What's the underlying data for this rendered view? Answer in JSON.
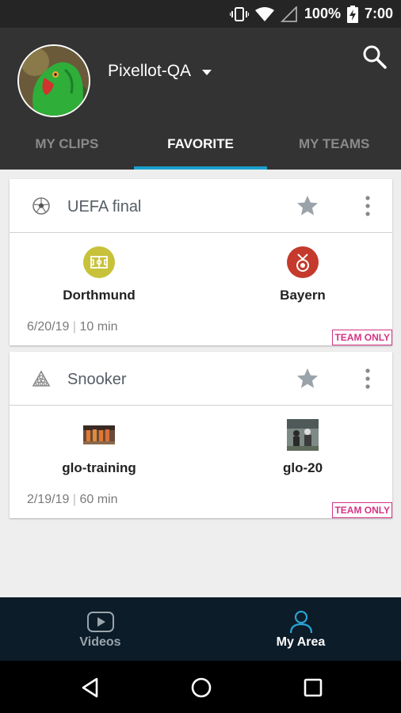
{
  "status_bar": {
    "battery": "100%",
    "time": "7:00"
  },
  "header": {
    "account_name": "Pixellot-QA",
    "avatar_icon": "parrot-avatar",
    "search_icon": "search-icon"
  },
  "tabs": [
    {
      "label": "MY CLIPS",
      "active": false
    },
    {
      "label": "FAVORITE",
      "active": true
    },
    {
      "label": "MY TEAMS",
      "active": false
    }
  ],
  "cards": [
    {
      "title": "UEFA final",
      "sport_icon": "soccer-ball-icon",
      "home_team": "Dorthmund",
      "away_team": "Bayern",
      "meta_date": "6/20/19",
      "meta_sep": "|",
      "meta_duration": "10 min",
      "badge": "TEAM ONLY"
    },
    {
      "title": "Snooker",
      "sport_icon": "snooker-rack-icon",
      "home_team": "glo-training",
      "away_team": "glo-20",
      "meta_date": "2/19/19",
      "meta_sep": "|",
      "meta_duration": "60 min",
      "badge": "TEAM ONLY"
    }
  ],
  "bottom_nav": [
    {
      "label": "Videos",
      "icon": "play-icon",
      "active": false
    },
    {
      "label": "My Area",
      "icon": "person-icon",
      "active": true
    }
  ],
  "colors": {
    "accent": "#1aa0cc",
    "header_bg": "#333333",
    "bottom_nav_bg": "#0c1c28",
    "badge": "#d63384"
  }
}
